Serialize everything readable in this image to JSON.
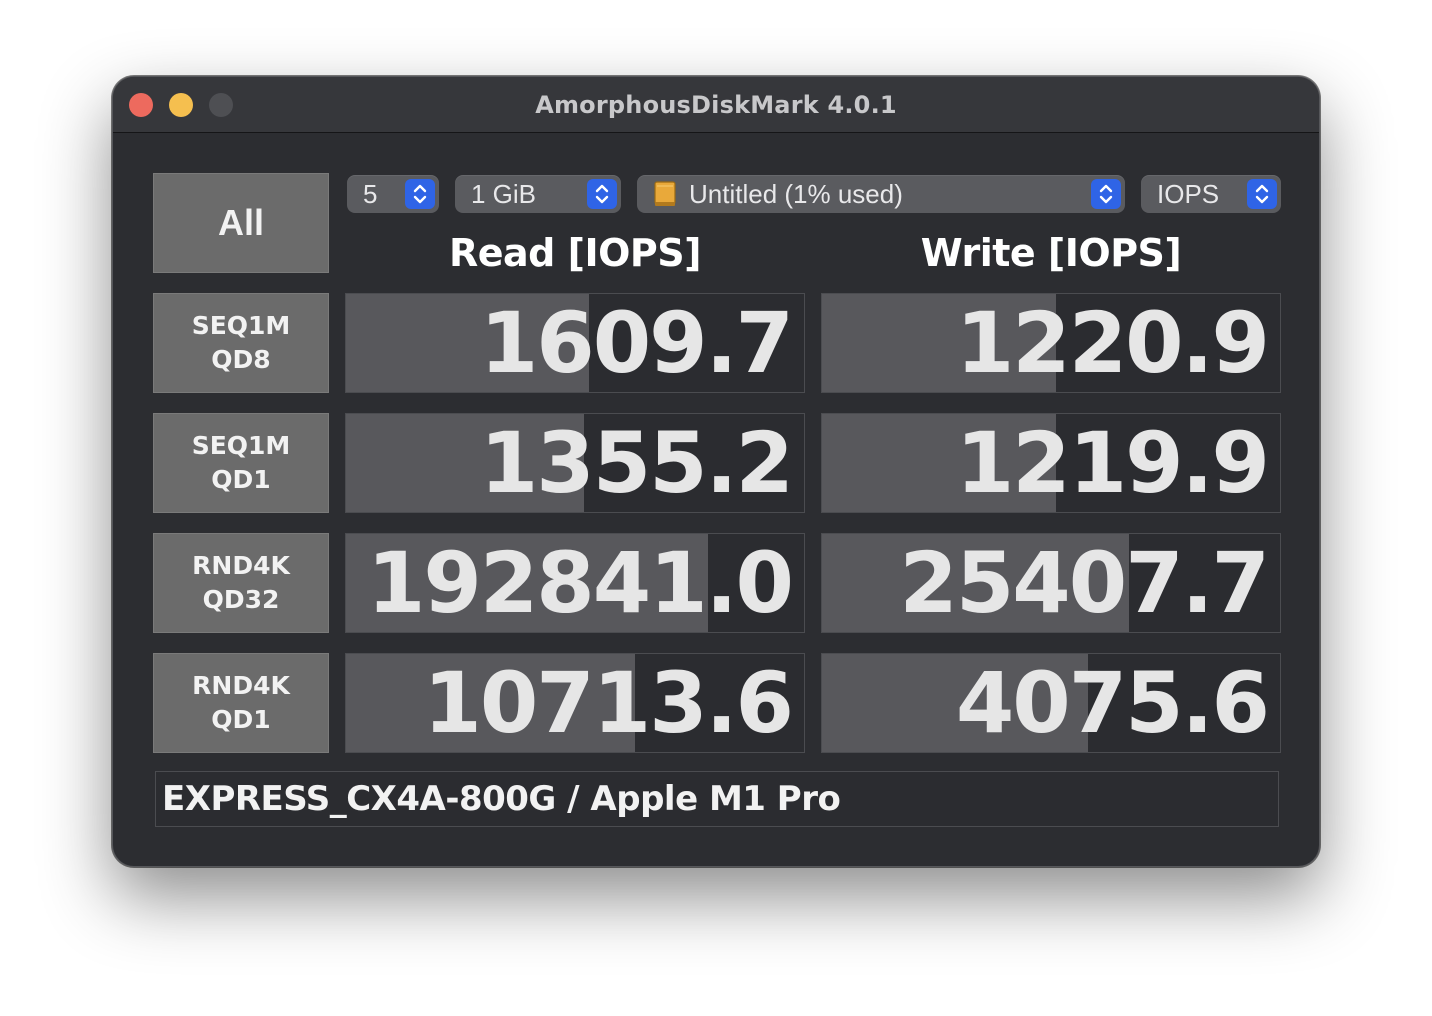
{
  "window": {
    "title": "AmorphousDiskMark 4.0.1"
  },
  "toolbar": {
    "all_label": "All",
    "count": {
      "value": "5"
    },
    "size": {
      "value": "1 GiB"
    },
    "drive": {
      "value": "Untitled (1% used)",
      "icon": "drive-icon"
    },
    "unit": {
      "value": "IOPS"
    }
  },
  "headers": {
    "read": "Read [IOPS]",
    "write": "Write [IOPS]"
  },
  "rows": [
    {
      "line1": "SEQ1M",
      "line2": "QD8",
      "read": "1609.7",
      "read_fill": 0.53,
      "write": "1220.9",
      "write_fill": 0.51
    },
    {
      "line1": "SEQ1M",
      "line2": "QD1",
      "read": "1355.2",
      "read_fill": 0.52,
      "write": "1219.9",
      "write_fill": 0.51
    },
    {
      "line1": "RND4K",
      "line2": "QD32",
      "read": "192841.0",
      "read_fill": 0.79,
      "write": "25407.7",
      "write_fill": 0.67
    },
    {
      "line1": "RND4K",
      "line2": "QD1",
      "read": "10713.6",
      "read_fill": 0.63,
      "write": "4075.6",
      "write_fill": 0.58
    }
  ],
  "footer": {
    "text": "EXPRESS_CX4A-800G / Apple M1 Pro"
  },
  "colors": {
    "window_bg": "#2c2d31",
    "button_bg": "#6b6b6b",
    "bar_fill": "#58585c",
    "stepper_accent": "#2f64e6",
    "close": "#ed6a5e",
    "minimize": "#f5bf4f"
  }
}
